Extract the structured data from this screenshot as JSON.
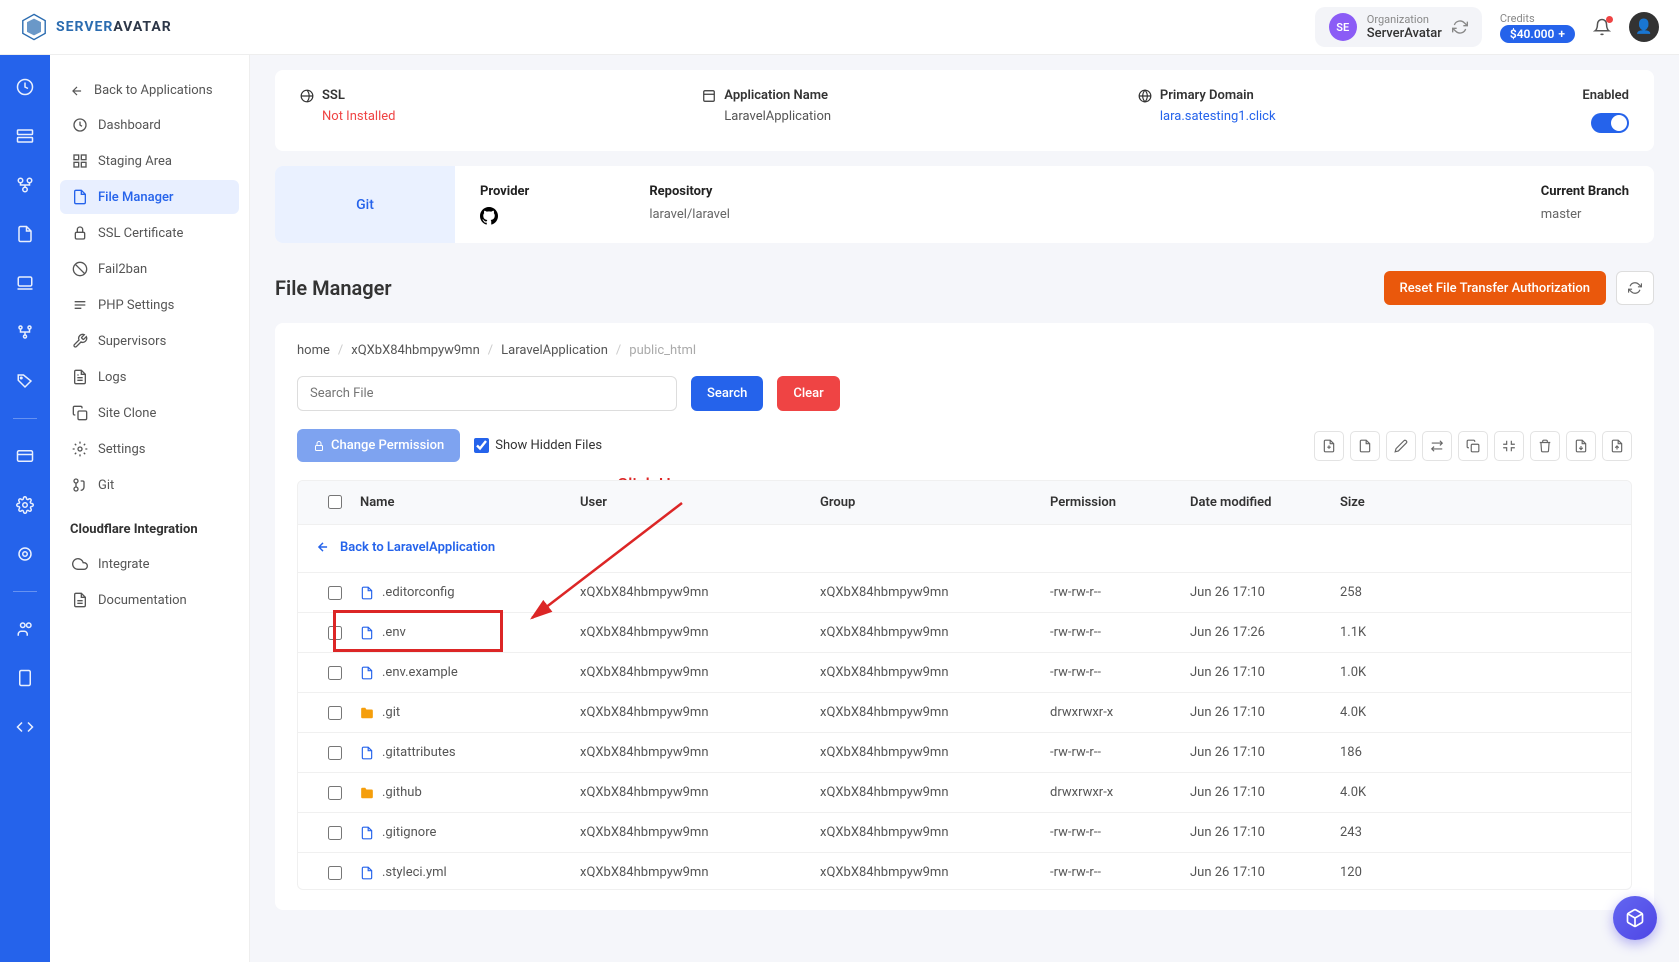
{
  "topbar": {
    "logo_text1": "SERVER",
    "logo_text2": "AVATAR",
    "org_label": "Organization",
    "org_name": "ServerAvatar",
    "org_initials": "SE",
    "credits_label": "Credits",
    "credits_value": "$40.000"
  },
  "sidebar": {
    "back": "Back to Applications",
    "items": [
      {
        "label": "Dashboard"
      },
      {
        "label": "Staging Area"
      },
      {
        "label": "File Manager"
      },
      {
        "label": "SSL Certificate"
      },
      {
        "label": "Fail2ban"
      },
      {
        "label": "PHP Settings"
      },
      {
        "label": "Supervisors"
      },
      {
        "label": "Logs"
      },
      {
        "label": "Site Clone"
      },
      {
        "label": "Settings"
      },
      {
        "label": "Git"
      }
    ],
    "section": "Cloudflare Integration",
    "integrate": "Integrate",
    "docs": "Documentation"
  },
  "info": {
    "ssl_label": "SSL",
    "ssl_value": "Not Installed",
    "app_label": "Application Name",
    "app_value": "LaravelApplication",
    "domain_label": "Primary Domain",
    "domain_value": "lara.satesting1.click",
    "enabled_label": "Enabled"
  },
  "git": {
    "tab": "Git",
    "provider_label": "Provider",
    "repo_label": "Repository",
    "repo_value": "laravel/laravel",
    "branch_label": "Current Branch",
    "branch_value": "master"
  },
  "fm": {
    "title": "File Manager",
    "reset_btn": "Reset File Transfer Authorization",
    "breadcrumb": [
      "home",
      "xQXbX84hbmpyw9mn",
      "LaravelApplication",
      "public_html"
    ],
    "search_placeholder": "Search File",
    "search_btn": "Search",
    "clear_btn": "Clear",
    "perm_btn": "Change Permission",
    "hidden_label": "Show Hidden Files",
    "annotation": "Click Here",
    "back_link": "Back to LaravelApplication",
    "columns": {
      "name": "Name",
      "user": "User",
      "group": "Group",
      "perm": "Permission",
      "date": "Date modified",
      "size": "Size"
    },
    "files": [
      {
        "name": ".editorconfig",
        "type": "file",
        "user": "xQXbX84hbmpyw9mn",
        "group": "xQXbX84hbmpyw9mn",
        "perm": "-rw-rw-r--",
        "date": "Jun 26 17:10",
        "size": "258"
      },
      {
        "name": ".env",
        "type": "file",
        "user": "xQXbX84hbmpyw9mn",
        "group": "xQXbX84hbmpyw9mn",
        "perm": "-rw-rw-r--",
        "date": "Jun 26 17:26",
        "size": "1.1K",
        "highlight": true
      },
      {
        "name": ".env.example",
        "type": "file",
        "user": "xQXbX84hbmpyw9mn",
        "group": "xQXbX84hbmpyw9mn",
        "perm": "-rw-rw-r--",
        "date": "Jun 26 17:10",
        "size": "1.0K"
      },
      {
        "name": ".git",
        "type": "folder",
        "user": "xQXbX84hbmpyw9mn",
        "group": "xQXbX84hbmpyw9mn",
        "perm": "drwxrwxr-x",
        "date": "Jun 26 17:10",
        "size": "4.0K"
      },
      {
        "name": ".gitattributes",
        "type": "file",
        "user": "xQXbX84hbmpyw9mn",
        "group": "xQXbX84hbmpyw9mn",
        "perm": "-rw-rw-r--",
        "date": "Jun 26 17:10",
        "size": "186"
      },
      {
        "name": ".github",
        "type": "folder",
        "user": "xQXbX84hbmpyw9mn",
        "group": "xQXbX84hbmpyw9mn",
        "perm": "drwxrwxr-x",
        "date": "Jun 26 17:10",
        "size": "4.0K"
      },
      {
        "name": ".gitignore",
        "type": "file",
        "user": "xQXbX84hbmpyw9mn",
        "group": "xQXbX84hbmpyw9mn",
        "perm": "-rw-rw-r--",
        "date": "Jun 26 17:10",
        "size": "243"
      },
      {
        "name": ".styleci.yml",
        "type": "file",
        "user": "xQXbX84hbmpyw9mn",
        "group": "xQXbX84hbmpyw9mn",
        "perm": "-rw-rw-r--",
        "date": "Jun 26 17:10",
        "size": "120"
      }
    ]
  }
}
